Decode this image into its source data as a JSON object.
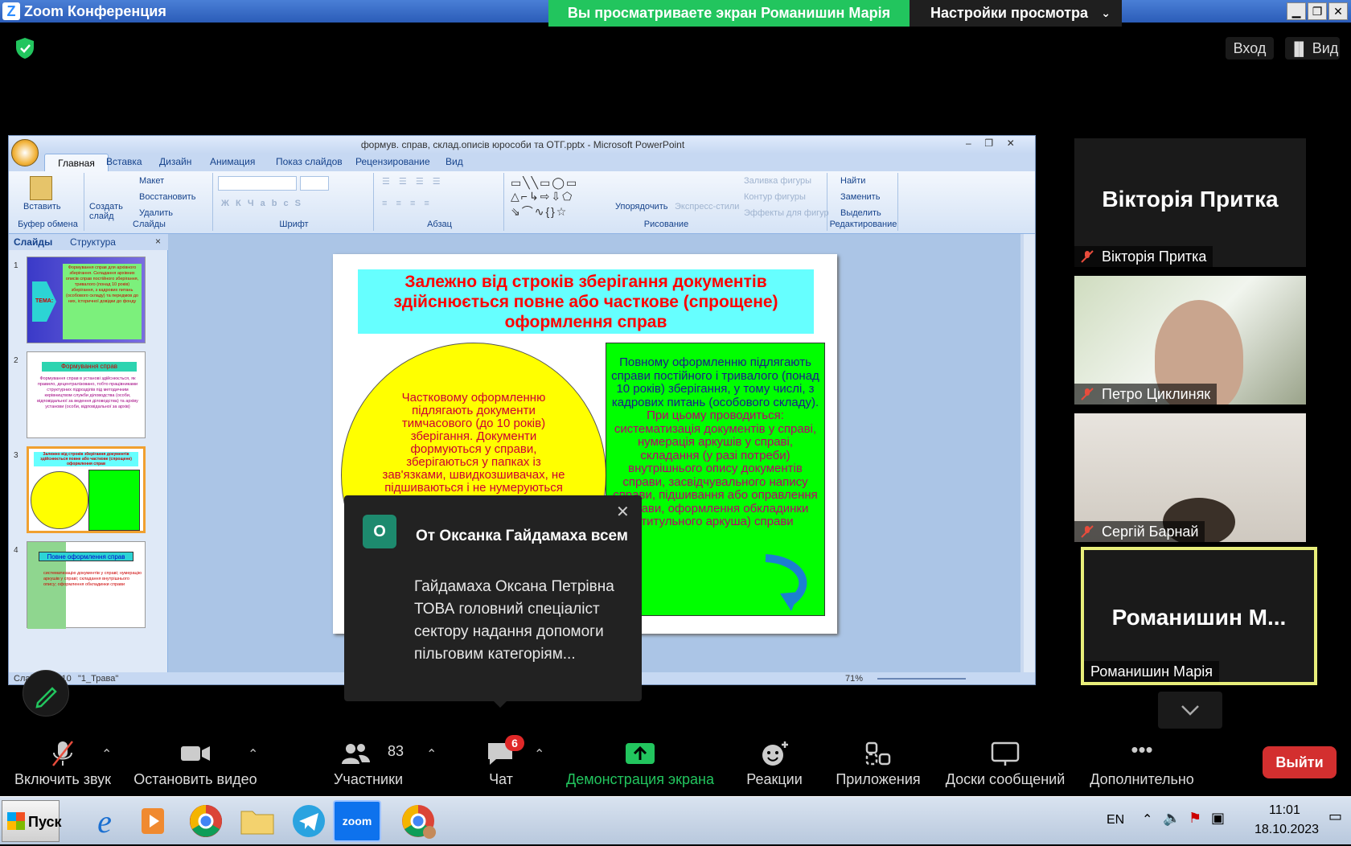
{
  "titlebar": {
    "title": "Zoom Конференция",
    "logo": "Z"
  },
  "share_banner": {
    "text": "Вы просматриваете экран Романишин Марія"
  },
  "view_options": {
    "label": "Настройки просмотра"
  },
  "window_controls": {
    "minimize": "▁",
    "restore": "❐",
    "close": "✕"
  },
  "top_right": {
    "enter_label": "Вход",
    "view_label": "Вид"
  },
  "ppt": {
    "window_title": "формув. справ, склад.описів юрособи та ОТГ.pptx - Microsoft PowerPoint",
    "tabs": [
      "Главная",
      "Вставка",
      "Дизайн",
      "Анимация",
      "Показ слайдов",
      "Рецензирование",
      "Вид"
    ],
    "ribbon": {
      "paste": "Вставить",
      "create_slide": "Создать слайд",
      "layout": "Макет",
      "reset": "Восстановить",
      "delete": "Удалить",
      "group_clipboard": "Буфер обмена",
      "group_slides": "Слайды",
      "group_font": "Шрифт",
      "group_paragraph": "Абзац",
      "arrange": "Упорядочить",
      "quick_styles": "Экспресс-стили",
      "shape_fill": "Заливка фигуры",
      "shape_outline": "Контур фигуры",
      "shape_effects": "Эффекты для фигур",
      "group_drawing": "Рисование",
      "find": "Найти",
      "replace": "Заменить",
      "select": "Выделить",
      "group_editing": "Редактирование"
    },
    "pane_tabs": {
      "slides": "Слайды",
      "outline": "Структура"
    },
    "thumb_numbers": [
      "1",
      "2",
      "3",
      "4"
    ],
    "thumb_texts": {
      "t1_side": "ТЕМА:",
      "t1_body": "Формування справ для архівного зберігання. Складання архівних описів справ постійного зберігання, тривалого (понад 10 років) зберігання, з кадрових питань (особового складу) та передмов до них, історичної довідки до фонду",
      "t2_title": "Формування справ",
      "t2_body": "Формування справ в установі здійснюється, як правило, децентралізовано, тобто працівниками структурних підрозділів під методичним керівництвом служби діловодства (особи, відповідальної за ведення діловодства) та архіву установи (особи, відповідальної за архів)",
      "t3_title": "Залежно від строків зберігання документів здійснюється повне або часткове (спрощене) оформлення справ",
      "t4_title": "Повне оформлення справ",
      "t4_body": "систематизацію документів у справі; нумерацію аркушів у справі; складання внутрішнього опису; оформлення обкладинки справи"
    },
    "status": {
      "slide": "Слайд 3 из 10",
      "theme": "\"1_Трава\"",
      "zoom": "71%"
    }
  },
  "slide": {
    "title": "Залежно від строків зберігання документів здійснюється повне або  часткове (спрощене) оформлення справ",
    "left_text": "Частковому оформленню підлягають документи тимчасового (до 10 років) зберігання. Документи формуються у справи, зберігаються у папках із зав'язками, швидкозшивачах, не підшиваються і не нумеруються (за винятком",
    "right_intro": "Повному оформленню підлягають справи постійного і тривалого (понад 10 років) зберігання, у тому числі, з кадрових питань (особового складу).",
    "right_sub": "При цьому проводиться:",
    "right_list": "систематизація документів у справі, нумерація аркушів у справі, складання (у разі потреби) внутрішнього опису документів справи, засвідчувального напису справи, підшивання або оправлення справи, оформлення обкладинки (титульного аркуша) справи"
  },
  "chat_popup": {
    "avatar": "О",
    "from": "От Оксанка Гайдамаха всем",
    "message": "Гайдамаха Оксана Петрівна ТОВА головний спеціаліст сектору надання допомоги пільговим  категоріям..."
  },
  "participants": [
    {
      "big": "Вікторія Притка",
      "name": "Вікторія Притка",
      "muted": true
    },
    {
      "big": "",
      "name": "Петро Циклиняк",
      "muted": true
    },
    {
      "big": "",
      "name": "Сергій Барнай",
      "muted": true
    },
    {
      "big": "Романишин  М...",
      "name": "Романишин Марія",
      "muted": false
    }
  ],
  "toolbar": {
    "unmute": "Включить звук",
    "stop_video": "Остановить видео",
    "participants": "Участники",
    "participants_count": "83",
    "chat": "Чат",
    "chat_badge": "6",
    "share": "Демонстрация экрана",
    "reactions": "Реакции",
    "apps": "Приложения",
    "whiteboards": "Доски сообщений",
    "more": "Дополнительно",
    "leave": "Выйти"
  },
  "taskbar": {
    "start": "Пуск",
    "lang": "EN",
    "time": "11:01",
    "date": "18.10.2023",
    "zoom_app": "zoom"
  },
  "colors": {
    "share_green": "#22c55e",
    "leave_red": "#d32f2f",
    "active_speaker": "#e8ee7a",
    "slide_title_bg": "#66ffff"
  }
}
